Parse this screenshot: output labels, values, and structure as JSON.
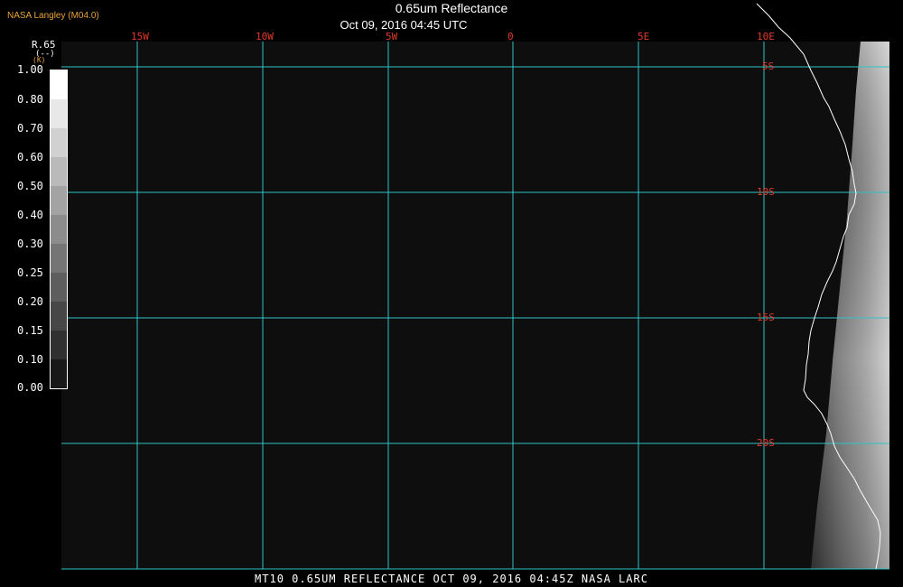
{
  "header": {
    "organization": "NASA Langley (M04.0)",
    "title": "0.65um Reflectance",
    "subtitle": "Oct 09, 2016 04:45 UTC"
  },
  "footer": {
    "caption": "MT10  0.65UM REFLECTANCE   OCT 09, 2016 04:45Z   NASA LARC"
  },
  "legend": {
    "variable": "R.65",
    "units": "(--)",
    "hidden_label": "(K)",
    "values": [
      "1.00",
      "0.80",
      "0.70",
      "0.60",
      "0.50",
      "0.40",
      "0.30",
      "0.25",
      "0.20",
      "0.15",
      "0.10",
      "0.00"
    ]
  },
  "map": {
    "longitude_labels": [
      "15W",
      "10W",
      "5W",
      "0",
      "5E",
      "10E"
    ],
    "latitude_labels": [
      "5S",
      "10S",
      "15S",
      "20S"
    ],
    "colors": {
      "gridline": "#2fc3c7",
      "grid_label": "#e23a2a",
      "coastline": "#ffffff",
      "background": "#0e0e0e"
    }
  }
}
